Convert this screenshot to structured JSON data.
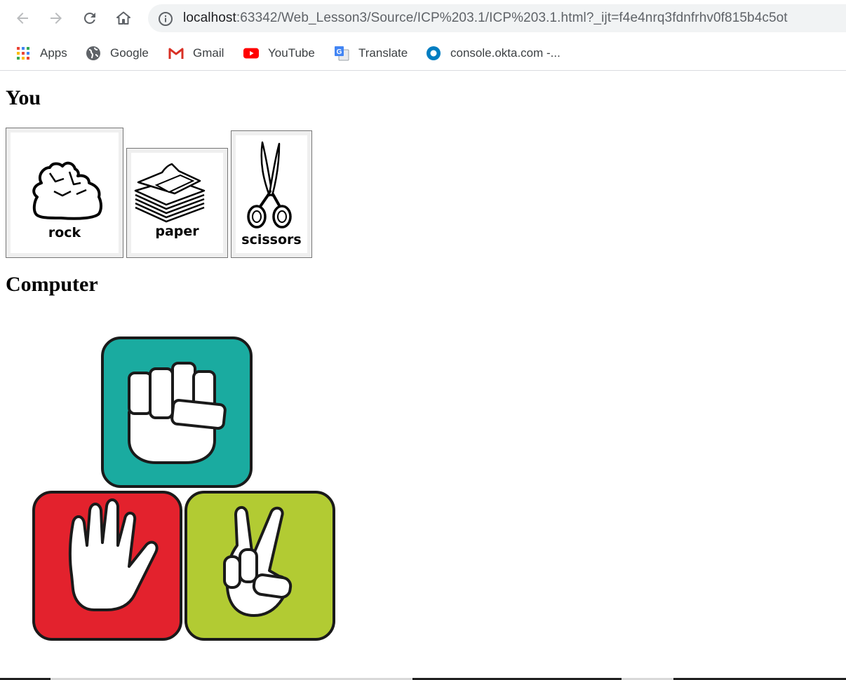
{
  "browser": {
    "url_host": "localhost",
    "url_rest": ":63342/Web_Lesson3/Source/ICP%203.1/ICP%203.1.html?_ijt=f4e4nrq3fdnfrhv0f815b4c5ot",
    "bookmarks": [
      {
        "label": "Apps",
        "icon": "apps-grid-icon"
      },
      {
        "label": "Google",
        "icon": "google-globe-icon"
      },
      {
        "label": "Gmail",
        "icon": "gmail-icon"
      },
      {
        "label": "YouTube",
        "icon": "youtube-icon"
      },
      {
        "label": "Translate",
        "icon": "translate-icon"
      },
      {
        "label": "console.okta.com -...",
        "icon": "okta-icon"
      }
    ]
  },
  "page": {
    "you_heading": "You",
    "computer_heading": "Computer",
    "choices": [
      {
        "label": "rock"
      },
      {
        "label": "paper"
      },
      {
        "label": "scissors"
      }
    ]
  },
  "colors": {
    "rock_block": "#1aaba0",
    "paper_block": "#e3222d",
    "scissors_block": "#b2cb33"
  }
}
